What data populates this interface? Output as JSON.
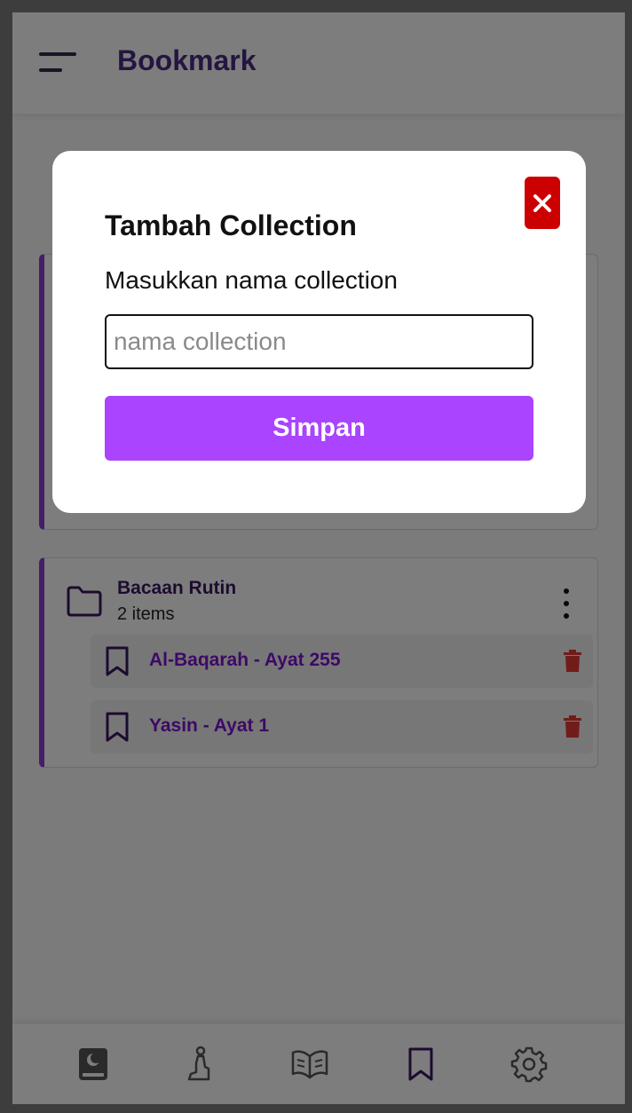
{
  "header": {
    "title": "Bookmark",
    "menu_icon": "hamburger-menu-icon"
  },
  "collections": [
    {
      "name": "Bacaan Rutin",
      "count": "2 items",
      "bookmarks": [
        {
          "label": "Al-Baqarah - Ayat 255"
        },
        {
          "label": "Yasin - Ayat 1"
        }
      ]
    }
  ],
  "modal": {
    "title": "Tambah Collection",
    "label": "Masukkan nama collection",
    "input_placeholder": "nama collection",
    "input_value": "",
    "save_label": "Simpan",
    "close_icon": "close-icon"
  },
  "bottom_nav": [
    {
      "icon": "quran-book-icon",
      "active": false
    },
    {
      "icon": "prayer-icon",
      "active": false
    },
    {
      "icon": "open-book-icon",
      "active": false
    },
    {
      "icon": "bookmark-icon",
      "active": true
    },
    {
      "icon": "gear-icon",
      "active": false
    }
  ],
  "colors": {
    "accent": "#8d3ad6",
    "title": "#4a2a82",
    "save_button": "#aa44ff",
    "close_button": "#cc0000",
    "trash": "#e53935"
  }
}
